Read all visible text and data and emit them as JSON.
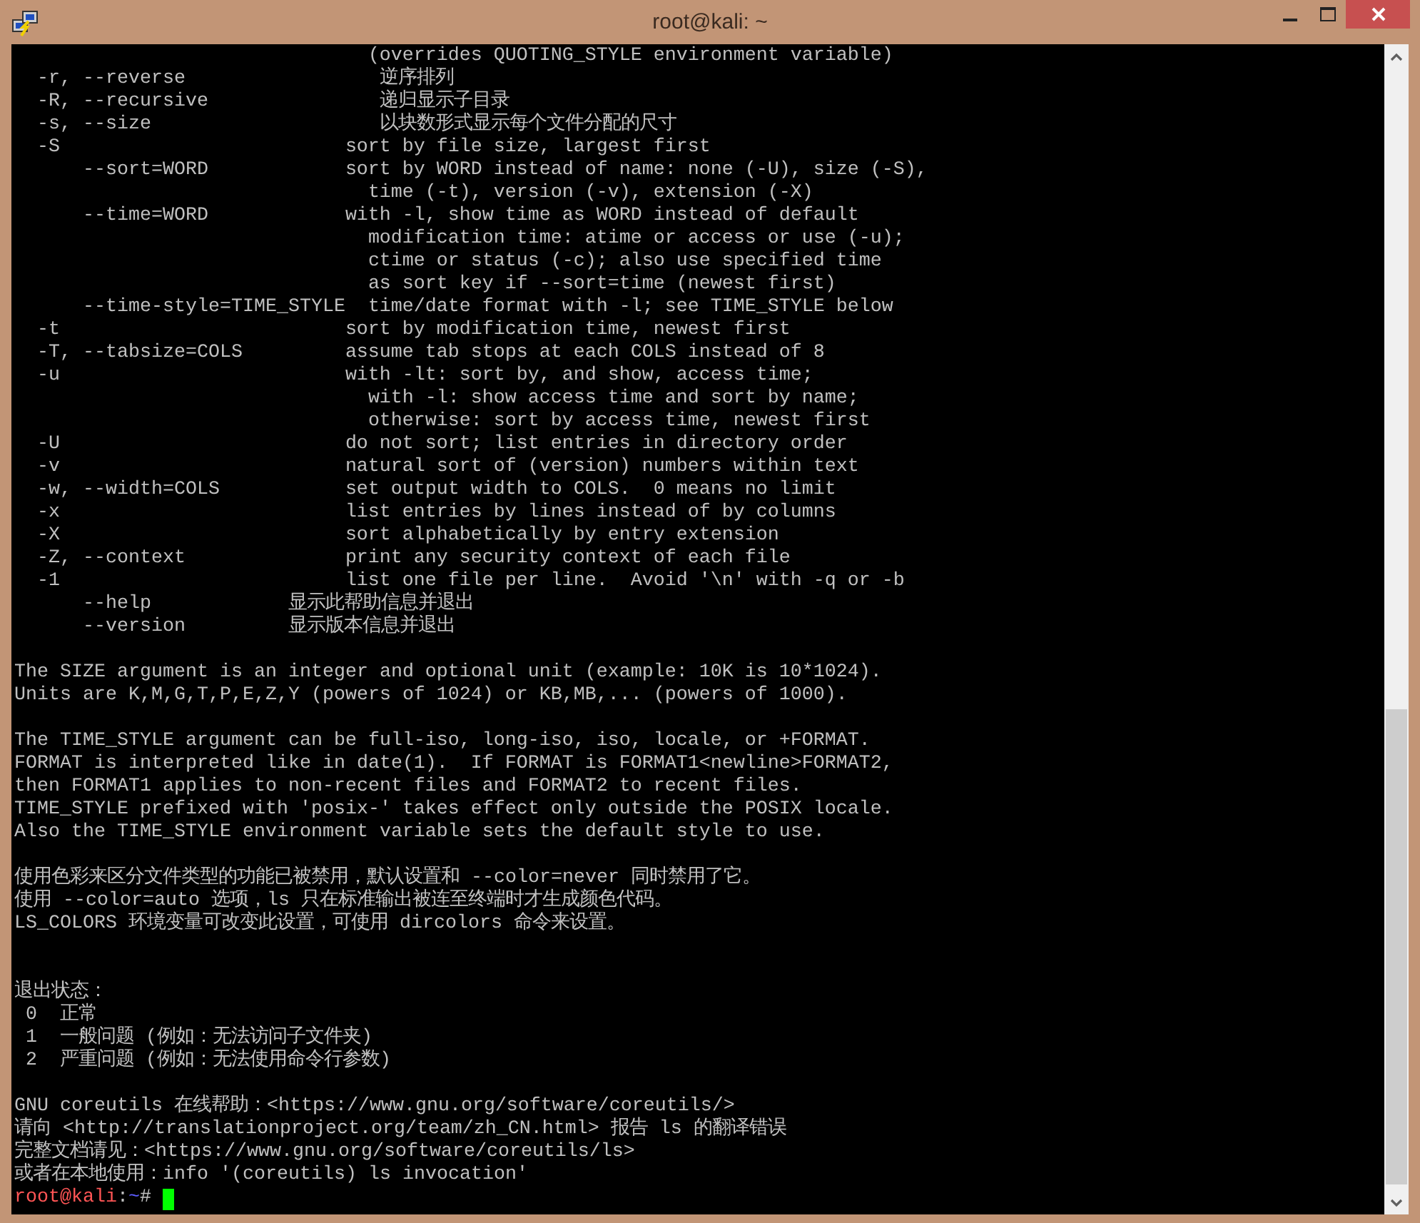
{
  "window": {
    "title": "root@kali: ~"
  },
  "terminal": {
    "lines": [
      {
        "kind": "cont",
        "description": "(overrides QUOTING_STYLE environment variable)"
      },
      {
        "kind": "opt_zh",
        "option": "-r, --reverse",
        "description": "逆序排列"
      },
      {
        "kind": "opt_zh",
        "option": "-R, --recursive",
        "description": "递归显示子目录"
      },
      {
        "kind": "opt_zh",
        "option": "-s, --size",
        "description": "以块数形式显示每个文件分配的尺寸"
      },
      {
        "kind": "opt",
        "option": "-S",
        "description": "sort by file size, largest first"
      },
      {
        "kind": "longopt",
        "option": "--sort=WORD",
        "description": "sort by WORD instead of name: none (-U), size (-S),"
      },
      {
        "kind": "cont",
        "description": "time (-t), version (-v), extension (-X)"
      },
      {
        "kind": "longopt",
        "option": "--time=WORD",
        "description": "with -l, show time as WORD instead of default"
      },
      {
        "kind": "cont",
        "description": "modification time: atime or access or use (-u);"
      },
      {
        "kind": "cont",
        "description": "ctime or status (-c); also use specified time"
      },
      {
        "kind": "cont",
        "description": "as sort key if --sort=time (newest first)"
      },
      {
        "kind": "longopt_wide",
        "option": "--time-style=TIME_STYLE",
        "description": "time/date format with -l; see TIME_STYLE below"
      },
      {
        "kind": "opt",
        "option": "-t",
        "description": "sort by modification time, newest first"
      },
      {
        "kind": "opt",
        "option": "-T, --tabsize=COLS",
        "description": "assume tab stops at each COLS instead of 8"
      },
      {
        "kind": "opt",
        "option": "-u",
        "description": "with -lt: sort by, and show, access time;"
      },
      {
        "kind": "cont",
        "description": "with -l: show access time and sort by name;"
      },
      {
        "kind": "cont",
        "description": "otherwise: sort by access time, newest first"
      },
      {
        "kind": "opt",
        "option": "-U",
        "description": "do not sort; list entries in directory order"
      },
      {
        "kind": "opt",
        "option": "-v",
        "description": "natural sort of (version) numbers within text"
      },
      {
        "kind": "opt",
        "option": "-w, --width=COLS",
        "description": "set output width to COLS.  0 means no limit"
      },
      {
        "kind": "opt",
        "option": "-x",
        "description": "list entries by lines instead of by columns"
      },
      {
        "kind": "opt",
        "option": "-X",
        "description": "sort alphabetically by entry extension"
      },
      {
        "kind": "opt",
        "option": "-Z, --context",
        "description": "print any security context of each file"
      },
      {
        "kind": "opt",
        "option": "-1",
        "description": "list one file per line.  Avoid '\\n' with -q or -b"
      },
      {
        "kind": "longopt_short",
        "option": "--help",
        "description": "显示此帮助信息并退出"
      },
      {
        "kind": "longopt_short",
        "option": "--version",
        "description": "显示版本信息并退出"
      },
      {
        "kind": "blank"
      },
      {
        "kind": "text",
        "text": "The SIZE argument is an integer and optional unit (example: 10K is 10*1024)."
      },
      {
        "kind": "text",
        "text": "Units are K,M,G,T,P,E,Z,Y (powers of 1024) or KB,MB,... (powers of 1000)."
      },
      {
        "kind": "blank"
      },
      {
        "kind": "text",
        "text": "The TIME_STYLE argument can be full-iso, long-iso, iso, locale, or +FORMAT."
      },
      {
        "kind": "text",
        "text": "FORMAT is interpreted like in date(1).  If FORMAT is FORMAT1<newline>FORMAT2,"
      },
      {
        "kind": "text",
        "text": "then FORMAT1 applies to non-recent files and FORMAT2 to recent files."
      },
      {
        "kind": "text",
        "text": "TIME_STYLE prefixed with 'posix-' takes effect only outside the POSIX locale."
      },
      {
        "kind": "text",
        "text": "Also the TIME_STYLE environment variable sets the default style to use."
      },
      {
        "kind": "blank"
      },
      {
        "kind": "text",
        "text": "使用色彩来区分文件类型的功能已被禁用，默认设置和 --color=never 同时禁用了它。"
      },
      {
        "kind": "text",
        "text": "使用 --color=auto 选项，ls 只在标准输出被连至终端时才生成颜色代码。"
      },
      {
        "kind": "text",
        "text": "LS_COLORS 环境变量可改变此设置，可使用 dircolors 命令来设置。"
      },
      {
        "kind": "blank"
      },
      {
        "kind": "blank"
      },
      {
        "kind": "text",
        "text": "退出状态："
      },
      {
        "kind": "exit",
        "code": "0",
        "description": "正常"
      },
      {
        "kind": "exit",
        "code": "1",
        "description": "一般问题 (例如：无法访问子文件夹)"
      },
      {
        "kind": "exit",
        "code": "2",
        "description": "严重问题 (例如：无法使用命令行参数)"
      },
      {
        "kind": "blank"
      },
      {
        "kind": "text",
        "text": "GNU coreutils 在线帮助：<https://www.gnu.org/software/coreutils/>"
      },
      {
        "kind": "text",
        "text": "请向 <http://translationproject.org/team/zh_CN.html> 报告 ls 的翻译错误"
      },
      {
        "kind": "text",
        "text": "完整文档请见：<https://www.gnu.org/software/coreutils/ls>"
      },
      {
        "kind": "text",
        "text": "或者在本地使用：info '(coreutils) ls invocation'"
      }
    ],
    "prompt": {
      "user_host": "root@kali",
      "separator": ":",
      "path": "~",
      "symbol": "#"
    }
  }
}
